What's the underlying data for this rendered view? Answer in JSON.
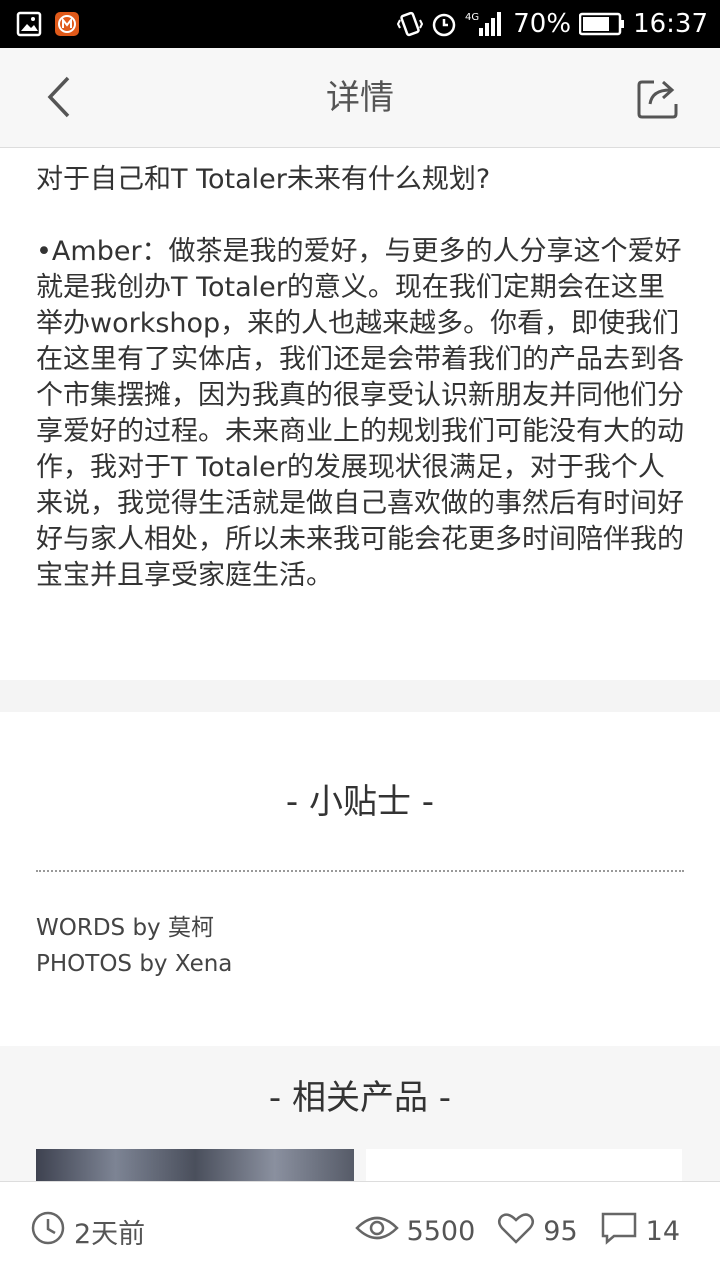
{
  "status_bar": {
    "battery_percent": "70%",
    "time": "16:37",
    "network": "4G",
    "icons": [
      "gallery-icon",
      "app-icon",
      "vibrate-icon",
      "alarm-icon",
      "signal-icon",
      "battery-icon"
    ]
  },
  "header": {
    "title": "详情",
    "icons": [
      "back-icon",
      "share-icon"
    ]
  },
  "article": {
    "question": "对于自己和T Totaler未来有什么规划?",
    "answer": "•Amber：做茶是我的爱好，与更多的人分享这个爱好就是我创办T Totaler的意义。现在我们定期会在这里举办workshop，来的人也越来越多。你看，即使我们在这里有了实体店，我们还是会带着我们的产品去到各个市集摆摊，因为我真的很享受认识新朋友并同他们分享爱好的过程。未来商业上的规划我们可能没有大的动作，我对于T Totaler的发展现状很满足，对于我个人来说，我觉得生活就是做自己喜欢做的事然后有时间好好与家人相处，所以未来我可能会花更多时间陪伴我的宝宝并且享受家庭生活。"
  },
  "tips": {
    "title": "- 小贴士 -",
    "credits": [
      "WORDS by 莫柯",
      "PHOTOS by Xena"
    ]
  },
  "related": {
    "title": "- 相关产品 -"
  },
  "footer": {
    "time_ago": "2天前",
    "views": "5500",
    "likes": "95",
    "comments": "14",
    "icons": [
      "clock-icon",
      "eye-icon",
      "heart-icon",
      "comment-icon"
    ]
  }
}
